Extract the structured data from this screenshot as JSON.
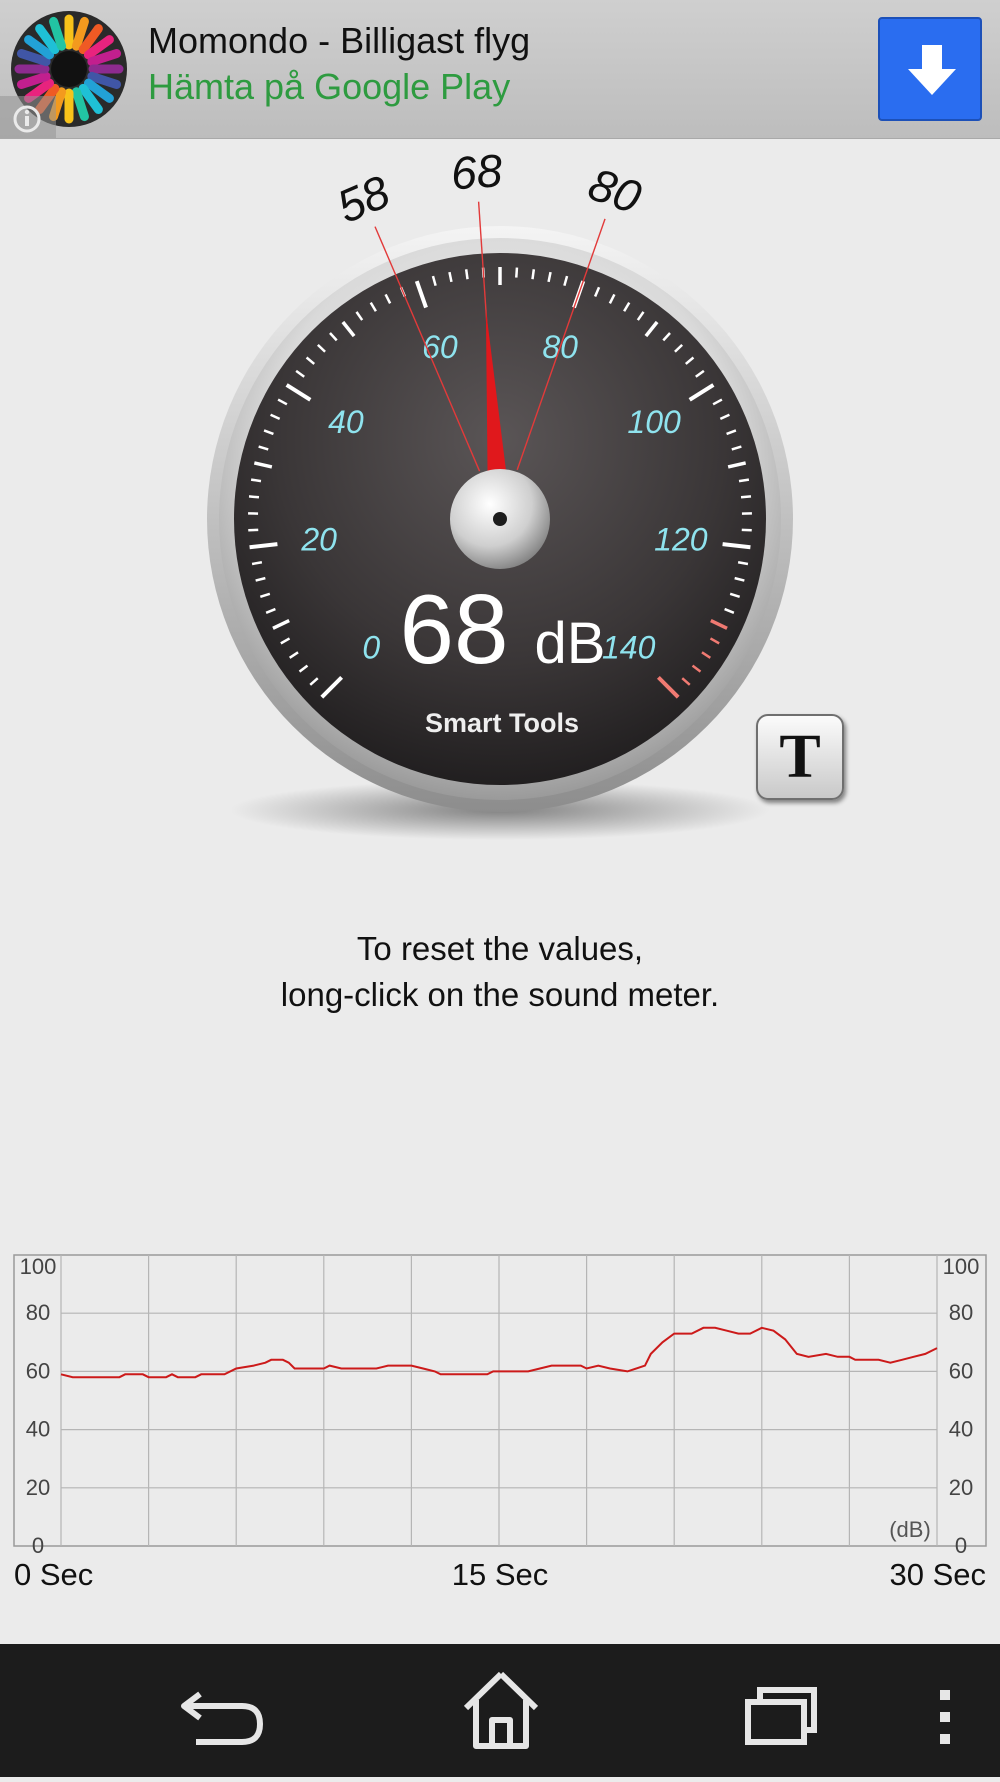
{
  "ad": {
    "title": "Momondo - Billigast flyg",
    "subtitle": "Hämta på Google Play",
    "logo_icon": "momondo-logo-icon",
    "info_icon": "ad-info-icon",
    "download_icon": "download-arrow-icon",
    "download_color": "#2a6df0",
    "subtitle_color": "#2e9b40"
  },
  "meter": {
    "min_label": "58",
    "current_label": "68",
    "max_label": "80",
    "min": 58,
    "current": 68,
    "max": 80,
    "scale_min": 0,
    "scale_max": 140,
    "scale_labels": [
      "0",
      "20",
      "40",
      "60",
      "80",
      "100",
      "120",
      "140"
    ],
    "reading_value": "68",
    "reading_unit": "dB",
    "brand": "Smart Tools",
    "needle_color": "#e0181c",
    "label_color": "#8fe3ee"
  },
  "t_button": {
    "label": "T"
  },
  "instructions": {
    "line1": "To reset the values,",
    "line2": "long-click on the sound meter."
  },
  "chart_data": {
    "type": "line",
    "title": "",
    "xlabel": "",
    "ylabel": "(dB)",
    "xlim": [
      0,
      30
    ],
    "ylim": [
      0,
      100
    ],
    "x_tick_labels": [
      "0 Sec",
      "15 Sec",
      "30 Sec"
    ],
    "y_tick_labels": [
      "0",
      "20",
      "40",
      "60",
      "80",
      "100"
    ],
    "unit_label": "(dB)",
    "grid": true,
    "line_color": "#cc1a1a",
    "series": [
      {
        "values": [
          [
            0,
            59
          ],
          [
            0.4,
            58
          ],
          [
            1.4,
            58
          ],
          [
            2.0,
            58
          ],
          [
            2.2,
            59
          ],
          [
            2.8,
            59
          ],
          [
            3.0,
            58
          ],
          [
            3.6,
            58
          ],
          [
            3.8,
            59
          ],
          [
            4.0,
            58
          ],
          [
            4.6,
            58
          ],
          [
            4.8,
            59
          ],
          [
            5.6,
            59
          ],
          [
            6.0,
            61
          ],
          [
            6.6,
            62
          ],
          [
            7.0,
            63
          ],
          [
            7.2,
            64
          ],
          [
            7.6,
            64
          ],
          [
            7.8,
            63
          ],
          [
            8.0,
            61
          ],
          [
            9.0,
            61
          ],
          [
            9.2,
            62
          ],
          [
            9.6,
            61
          ],
          [
            10.8,
            61
          ],
          [
            11.2,
            62
          ],
          [
            12.0,
            62
          ],
          [
            12.4,
            61
          ],
          [
            12.8,
            60
          ],
          [
            13.0,
            59
          ],
          [
            14.6,
            59
          ],
          [
            14.8,
            60
          ],
          [
            16.0,
            60
          ],
          [
            16.4,
            61
          ],
          [
            16.8,
            62
          ],
          [
            17.8,
            62
          ],
          [
            18.0,
            61
          ],
          [
            18.4,
            62
          ],
          [
            18.8,
            61
          ],
          [
            19.4,
            60
          ],
          [
            20.0,
            62
          ],
          [
            20.2,
            66
          ],
          [
            20.6,
            70
          ],
          [
            21.0,
            73
          ],
          [
            21.6,
            73
          ],
          [
            22.0,
            75
          ],
          [
            22.4,
            75
          ],
          [
            22.8,
            74
          ],
          [
            23.2,
            73
          ],
          [
            23.6,
            73
          ],
          [
            24.0,
            75
          ],
          [
            24.4,
            74
          ],
          [
            24.8,
            71
          ],
          [
            25.2,
            66
          ],
          [
            25.6,
            65
          ],
          [
            26.2,
            66
          ],
          [
            26.6,
            65
          ],
          [
            27.0,
            65
          ],
          [
            27.2,
            64
          ],
          [
            28.0,
            64
          ],
          [
            28.4,
            63
          ],
          [
            28.8,
            64
          ],
          [
            29.2,
            65
          ],
          [
            29.6,
            66
          ],
          [
            30,
            68
          ]
        ]
      }
    ]
  },
  "nav": {
    "back_icon": "back-icon",
    "home_icon": "home-icon",
    "recents_icon": "recent-apps-icon",
    "menu_icon": "overflow-menu-icon"
  }
}
